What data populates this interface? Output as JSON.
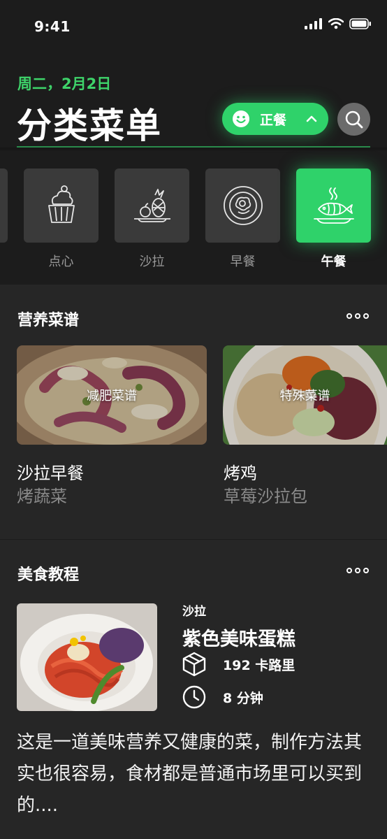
{
  "status_bar": {
    "time": "9:41"
  },
  "header": {
    "date": "周二，2月2日",
    "title": "分类菜单",
    "meal_toggle_label": "正餐"
  },
  "categories": [
    {
      "label": "点心",
      "icon": "cupcake-icon",
      "active": false
    },
    {
      "label": "沙拉",
      "icon": "fruit-icon",
      "active": false
    },
    {
      "label": "早餐",
      "icon": "breakfast-plate-icon",
      "active": false
    },
    {
      "label": "午餐",
      "icon": "fish-dish-icon",
      "active": true
    }
  ],
  "nutrition": {
    "title": "营养菜谱",
    "cards": [
      {
        "overlay": "减肥菜谱",
        "title": "沙拉早餐",
        "subtitle": "烤蔬菜"
      },
      {
        "overlay": "特殊菜谱",
        "title": "烤鸡",
        "subtitle": "草莓沙拉包"
      }
    ]
  },
  "tutorial": {
    "title": "美食教程",
    "category": "沙拉",
    "dish": "紫色美味蛋糕",
    "calories": "192  卡路里",
    "time": "8 分钟",
    "description": "这是一道美味营养又健康的菜，制作方法其实也很容易，食材都是普通市场里可以买到的...."
  },
  "colors": {
    "accent": "#2fd26a",
    "background": "#1c1c1c",
    "section": "#262626"
  }
}
